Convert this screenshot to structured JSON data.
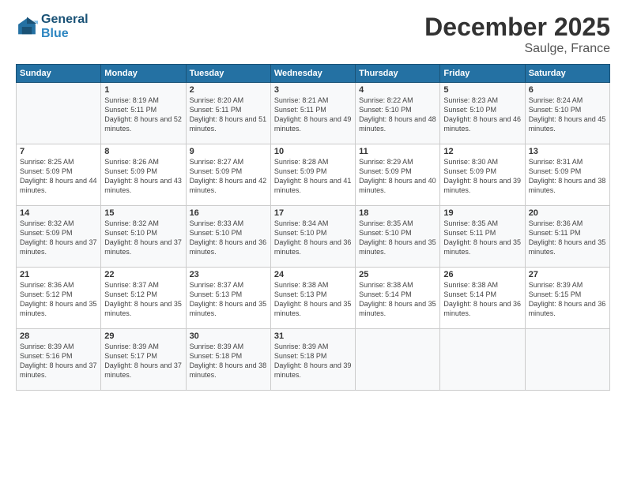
{
  "logo": {
    "line1": "General",
    "line2": "Blue"
  },
  "title": "December 2025",
  "subtitle": "Saulge, France",
  "days": [
    "Sunday",
    "Monday",
    "Tuesday",
    "Wednesday",
    "Thursday",
    "Friday",
    "Saturday"
  ],
  "weeks": [
    [
      {
        "day": "",
        "sunrise": "",
        "sunset": "",
        "daylight": ""
      },
      {
        "day": "1",
        "sunrise": "Sunrise: 8:19 AM",
        "sunset": "Sunset: 5:11 PM",
        "daylight": "Daylight: 8 hours and 52 minutes."
      },
      {
        "day": "2",
        "sunrise": "Sunrise: 8:20 AM",
        "sunset": "Sunset: 5:11 PM",
        "daylight": "Daylight: 8 hours and 51 minutes."
      },
      {
        "day": "3",
        "sunrise": "Sunrise: 8:21 AM",
        "sunset": "Sunset: 5:11 PM",
        "daylight": "Daylight: 8 hours and 49 minutes."
      },
      {
        "day": "4",
        "sunrise": "Sunrise: 8:22 AM",
        "sunset": "Sunset: 5:10 PM",
        "daylight": "Daylight: 8 hours and 48 minutes."
      },
      {
        "day": "5",
        "sunrise": "Sunrise: 8:23 AM",
        "sunset": "Sunset: 5:10 PM",
        "daylight": "Daylight: 8 hours and 46 minutes."
      },
      {
        "day": "6",
        "sunrise": "Sunrise: 8:24 AM",
        "sunset": "Sunset: 5:10 PM",
        "daylight": "Daylight: 8 hours and 45 minutes."
      }
    ],
    [
      {
        "day": "7",
        "sunrise": "Sunrise: 8:25 AM",
        "sunset": "Sunset: 5:09 PM",
        "daylight": "Daylight: 8 hours and 44 minutes."
      },
      {
        "day": "8",
        "sunrise": "Sunrise: 8:26 AM",
        "sunset": "Sunset: 5:09 PM",
        "daylight": "Daylight: 8 hours and 43 minutes."
      },
      {
        "day": "9",
        "sunrise": "Sunrise: 8:27 AM",
        "sunset": "Sunset: 5:09 PM",
        "daylight": "Daylight: 8 hours and 42 minutes."
      },
      {
        "day": "10",
        "sunrise": "Sunrise: 8:28 AM",
        "sunset": "Sunset: 5:09 PM",
        "daylight": "Daylight: 8 hours and 41 minutes."
      },
      {
        "day": "11",
        "sunrise": "Sunrise: 8:29 AM",
        "sunset": "Sunset: 5:09 PM",
        "daylight": "Daylight: 8 hours and 40 minutes."
      },
      {
        "day": "12",
        "sunrise": "Sunrise: 8:30 AM",
        "sunset": "Sunset: 5:09 PM",
        "daylight": "Daylight: 8 hours and 39 minutes."
      },
      {
        "day": "13",
        "sunrise": "Sunrise: 8:31 AM",
        "sunset": "Sunset: 5:09 PM",
        "daylight": "Daylight: 8 hours and 38 minutes."
      }
    ],
    [
      {
        "day": "14",
        "sunrise": "Sunrise: 8:32 AM",
        "sunset": "Sunset: 5:09 PM",
        "daylight": "Daylight: 8 hours and 37 minutes."
      },
      {
        "day": "15",
        "sunrise": "Sunrise: 8:32 AM",
        "sunset": "Sunset: 5:10 PM",
        "daylight": "Daylight: 8 hours and 37 minutes."
      },
      {
        "day": "16",
        "sunrise": "Sunrise: 8:33 AM",
        "sunset": "Sunset: 5:10 PM",
        "daylight": "Daylight: 8 hours and 36 minutes."
      },
      {
        "day": "17",
        "sunrise": "Sunrise: 8:34 AM",
        "sunset": "Sunset: 5:10 PM",
        "daylight": "Daylight: 8 hours and 36 minutes."
      },
      {
        "day": "18",
        "sunrise": "Sunrise: 8:35 AM",
        "sunset": "Sunset: 5:10 PM",
        "daylight": "Daylight: 8 hours and 35 minutes."
      },
      {
        "day": "19",
        "sunrise": "Sunrise: 8:35 AM",
        "sunset": "Sunset: 5:11 PM",
        "daylight": "Daylight: 8 hours and 35 minutes."
      },
      {
        "day": "20",
        "sunrise": "Sunrise: 8:36 AM",
        "sunset": "Sunset: 5:11 PM",
        "daylight": "Daylight: 8 hours and 35 minutes."
      }
    ],
    [
      {
        "day": "21",
        "sunrise": "Sunrise: 8:36 AM",
        "sunset": "Sunset: 5:12 PM",
        "daylight": "Daylight: 8 hours and 35 minutes."
      },
      {
        "day": "22",
        "sunrise": "Sunrise: 8:37 AM",
        "sunset": "Sunset: 5:12 PM",
        "daylight": "Daylight: 8 hours and 35 minutes."
      },
      {
        "day": "23",
        "sunrise": "Sunrise: 8:37 AM",
        "sunset": "Sunset: 5:13 PM",
        "daylight": "Daylight: 8 hours and 35 minutes."
      },
      {
        "day": "24",
        "sunrise": "Sunrise: 8:38 AM",
        "sunset": "Sunset: 5:13 PM",
        "daylight": "Daylight: 8 hours and 35 minutes."
      },
      {
        "day": "25",
        "sunrise": "Sunrise: 8:38 AM",
        "sunset": "Sunset: 5:14 PM",
        "daylight": "Daylight: 8 hours and 35 minutes."
      },
      {
        "day": "26",
        "sunrise": "Sunrise: 8:38 AM",
        "sunset": "Sunset: 5:14 PM",
        "daylight": "Daylight: 8 hours and 36 minutes."
      },
      {
        "day": "27",
        "sunrise": "Sunrise: 8:39 AM",
        "sunset": "Sunset: 5:15 PM",
        "daylight": "Daylight: 8 hours and 36 minutes."
      }
    ],
    [
      {
        "day": "28",
        "sunrise": "Sunrise: 8:39 AM",
        "sunset": "Sunset: 5:16 PM",
        "daylight": "Daylight: 8 hours and 37 minutes."
      },
      {
        "day": "29",
        "sunrise": "Sunrise: 8:39 AM",
        "sunset": "Sunset: 5:17 PM",
        "daylight": "Daylight: 8 hours and 37 minutes."
      },
      {
        "day": "30",
        "sunrise": "Sunrise: 8:39 AM",
        "sunset": "Sunset: 5:18 PM",
        "daylight": "Daylight: 8 hours and 38 minutes."
      },
      {
        "day": "31",
        "sunrise": "Sunrise: 8:39 AM",
        "sunset": "Sunset: 5:18 PM",
        "daylight": "Daylight: 8 hours and 39 minutes."
      },
      {
        "day": "",
        "sunrise": "",
        "sunset": "",
        "daylight": ""
      },
      {
        "day": "",
        "sunrise": "",
        "sunset": "",
        "daylight": ""
      },
      {
        "day": "",
        "sunrise": "",
        "sunset": "",
        "daylight": ""
      }
    ]
  ]
}
